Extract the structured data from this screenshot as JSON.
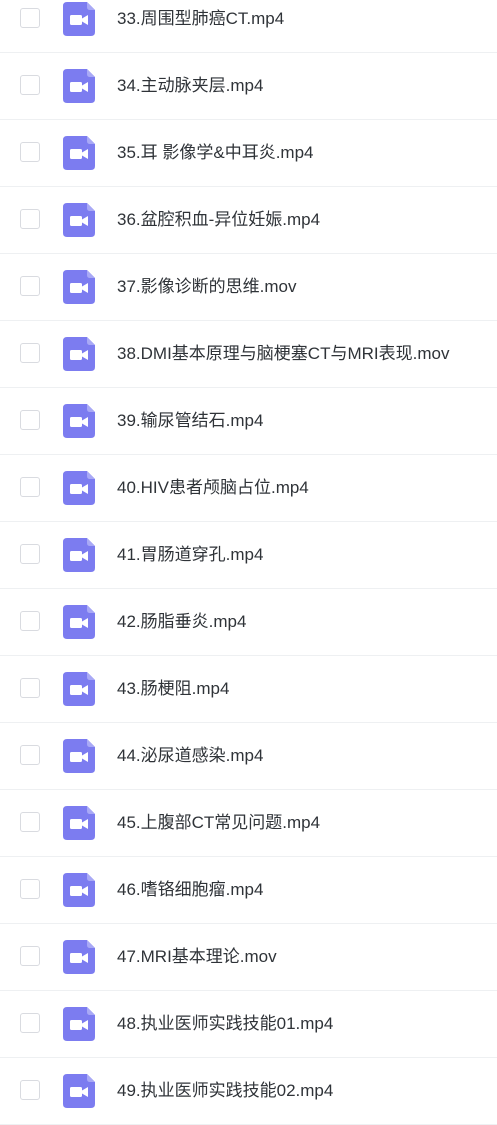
{
  "colors": {
    "icon_bg": "#7c7cf0",
    "icon_glyph": "#ffffff",
    "text": "#2f3338",
    "divider": "#eef0f2",
    "checkbox_border": "#d9dbe0"
  },
  "file_icon_name": "video-file-icon",
  "files": [
    {
      "name": "33.周围型肺癌CT.mp4"
    },
    {
      "name": "34.主动脉夹层.mp4"
    },
    {
      "name": "35.耳 影像学&中耳炎.mp4"
    },
    {
      "name": "36.盆腔积血-异位妊娠.mp4"
    },
    {
      "name": "37.影像诊断的思维.mov"
    },
    {
      "name": "38.DMI基本原理与脑梗塞CT与MRI表现.mov"
    },
    {
      "name": "39.输尿管结石.mp4"
    },
    {
      "name": "40.HIV患者颅脑占位.mp4"
    },
    {
      "name": "41.胃肠道穿孔.mp4"
    },
    {
      "name": "42.肠脂垂炎.mp4"
    },
    {
      "name": "43.肠梗阻.mp4"
    },
    {
      "name": "44.泌尿道感染.mp4"
    },
    {
      "name": "45.上腹部CT常见问题.mp4"
    },
    {
      "name": "46.嗜铬细胞瘤.mp4"
    },
    {
      "name": "47.MRI基本理论.mov"
    },
    {
      "name": "48.执业医师实践技能01.mp4"
    },
    {
      "name": "49.执业医师实践技能02.mp4"
    }
  ]
}
